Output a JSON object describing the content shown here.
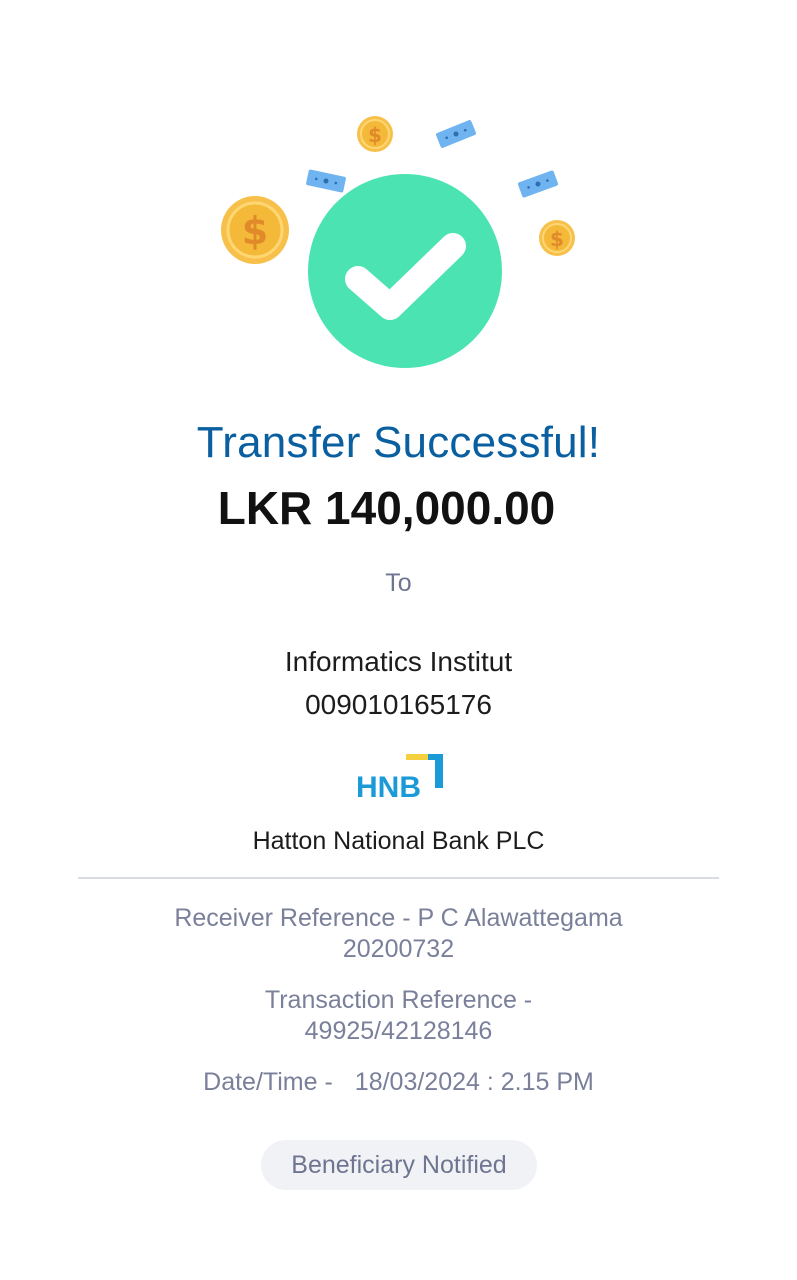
{
  "status": {
    "title": "Transfer Successful!",
    "amount": "LKR 140,000.00",
    "success_color": "#4be3b2",
    "icon": "check-circle-icon"
  },
  "recipient": {
    "to_label": "To",
    "name": "Informatics Institut",
    "account_number": "009010165176",
    "bank_logo_text": "HNB",
    "bank_name": "Hatton National Bank PLC"
  },
  "details": {
    "receiver_reference_line1": "Receiver Reference - P C Alawattegama",
    "receiver_reference_line2": "20200732",
    "transaction_reference_line1": "Transaction Reference -",
    "transaction_reference_line2": "49925/42128146",
    "datetime_label": "Date/Time -",
    "datetime_value": "18/03/2024 : 2.15 PM"
  },
  "badge": {
    "label": "Beneficiary Notified"
  },
  "colors": {
    "title": "#0a5fa0",
    "detail_text": "#7a7f9a",
    "coin": "#f7c04a",
    "banknote": "#6fb3f0",
    "hnb_blue": "#1a9ad6",
    "hnb_yellow": "#f4d03f"
  }
}
